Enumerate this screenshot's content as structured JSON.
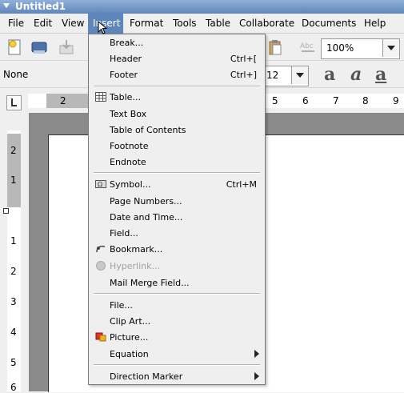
{
  "window": {
    "title": "Untitled1"
  },
  "menubar": {
    "items": [
      {
        "label": "File"
      },
      {
        "label": "Edit"
      },
      {
        "label": "View"
      },
      {
        "label": "Insert"
      },
      {
        "label": "Format"
      },
      {
        "label": "Tools"
      },
      {
        "label": "Table"
      },
      {
        "label": "Collaborate"
      },
      {
        "label": "Documents"
      },
      {
        "label": "Help"
      }
    ]
  },
  "toolbar": {
    "zoom_value": "100%"
  },
  "format_toolbar": {
    "style_value": "None",
    "font_size": "12"
  },
  "ruler": {
    "h_numbers": [
      "2",
      "5",
      "6",
      "7",
      "8",
      "9"
    ],
    "v_numbers": [
      "2",
      "1",
      "1",
      "2",
      "3",
      "4",
      "5",
      "6"
    ]
  },
  "insert_menu": {
    "items": [
      {
        "label": "Break...",
        "shortcut": ""
      },
      {
        "label": "Header",
        "shortcut": "Ctrl+["
      },
      {
        "label": "Footer",
        "shortcut": "Ctrl+]"
      },
      {
        "label": "Table...",
        "shortcut": ""
      },
      {
        "label": "Text Box",
        "shortcut": ""
      },
      {
        "label": "Table of Contents",
        "shortcut": ""
      },
      {
        "label": "Footnote",
        "shortcut": ""
      },
      {
        "label": "Endnote",
        "shortcut": ""
      },
      {
        "label": "Symbol...",
        "shortcut": "Ctrl+M"
      },
      {
        "label": "Page Numbers...",
        "shortcut": ""
      },
      {
        "label": "Date and Time...",
        "shortcut": ""
      },
      {
        "label": "Field...",
        "shortcut": ""
      },
      {
        "label": "Bookmark...",
        "shortcut": ""
      },
      {
        "label": "Hyperlink...",
        "shortcut": ""
      },
      {
        "label": "Mail Merge Field...",
        "shortcut": ""
      },
      {
        "label": "File...",
        "shortcut": ""
      },
      {
        "label": "Clip Art...",
        "shortcut": ""
      },
      {
        "label": "Picture...",
        "shortcut": ""
      },
      {
        "label": "Equation",
        "shortcut": ""
      },
      {
        "label": "Direction Marker",
        "shortcut": ""
      }
    ]
  },
  "colors": {
    "titlebar": "#6e93c6",
    "menu_highlight": "#5f86bb",
    "disabled_text": "#a0a0a0"
  }
}
